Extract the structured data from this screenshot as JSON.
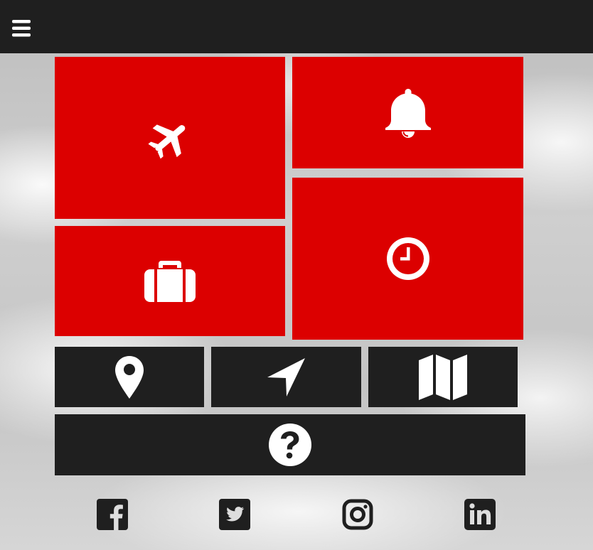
{
  "header": {
    "menu_icon": "bars-icon"
  },
  "tiles": {
    "flights": {
      "icon": "plane-icon",
      "color": "#dc0000"
    },
    "notifications": {
      "icon": "bell-icon",
      "color": "#dc0000"
    },
    "baggage": {
      "icon": "suitcase-icon",
      "color": "#dc0000"
    },
    "time": {
      "icon": "clock-icon",
      "color": "#dc0000"
    },
    "location": {
      "icon": "map-marker-icon",
      "color": "#1f1f1f"
    },
    "navigation": {
      "icon": "location-arrow-icon",
      "color": "#1f1f1f"
    },
    "map": {
      "icon": "map-icon",
      "color": "#1f1f1f"
    },
    "help": {
      "icon": "question-circle-icon",
      "color": "#1f1f1f"
    }
  },
  "social": [
    {
      "icon": "facebook-icon"
    },
    {
      "icon": "twitter-icon"
    },
    {
      "icon": "instagram-icon"
    },
    {
      "icon": "linkedin-icon"
    }
  ],
  "colors": {
    "accent": "#dc0000",
    "dark": "#1f1f1f",
    "icon": "#ffffff"
  }
}
